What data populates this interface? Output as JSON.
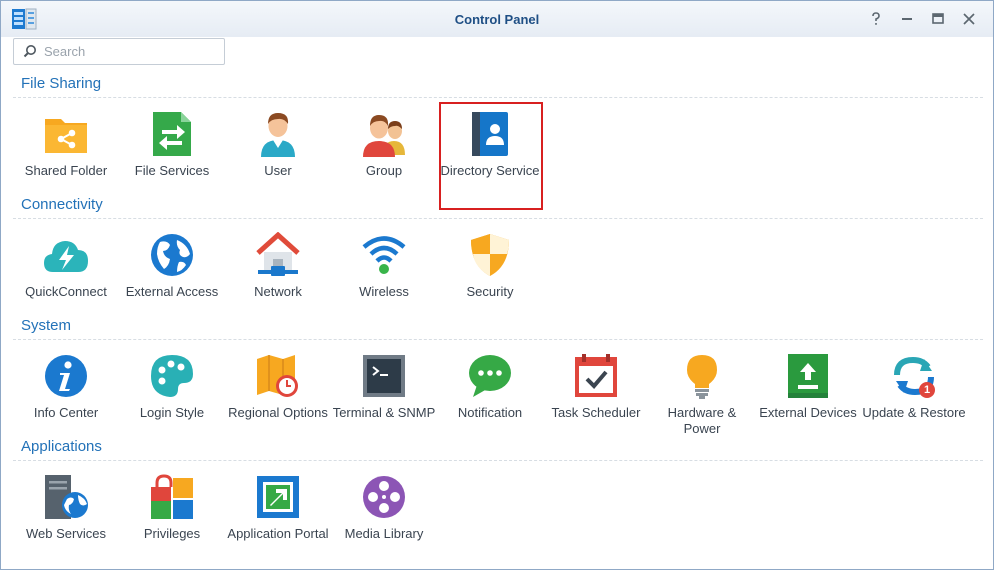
{
  "window": {
    "title": "Control Panel"
  },
  "search": {
    "placeholder": "Search"
  },
  "sections": [
    {
      "title": "File Sharing",
      "items": [
        {
          "label": "Shared Folder",
          "icon": "shared-folder-icon"
        },
        {
          "label": "File Services",
          "icon": "file-services-icon"
        },
        {
          "label": "User",
          "icon": "user-icon"
        },
        {
          "label": "Group",
          "icon": "group-icon"
        },
        {
          "label": "Directory Service",
          "icon": "directory-service-icon",
          "highlighted": true
        }
      ]
    },
    {
      "title": "Connectivity",
      "items": [
        {
          "label": "QuickConnect",
          "icon": "quickconnect-icon"
        },
        {
          "label": "External Access",
          "icon": "external-access-icon"
        },
        {
          "label": "Network",
          "icon": "network-icon"
        },
        {
          "label": "Wireless",
          "icon": "wireless-icon"
        },
        {
          "label": "Security",
          "icon": "security-icon"
        }
      ]
    },
    {
      "title": "System",
      "items": [
        {
          "label": "Info Center",
          "icon": "info-center-icon"
        },
        {
          "label": "Login Style",
          "icon": "login-style-icon"
        },
        {
          "label": "Regional Options",
          "icon": "regional-options-icon"
        },
        {
          "label": "Terminal & SNMP",
          "icon": "terminal-snmp-icon"
        },
        {
          "label": "Notification",
          "icon": "notification-icon"
        },
        {
          "label": "Task Scheduler",
          "icon": "task-scheduler-icon"
        },
        {
          "label": "Hardware & Power",
          "icon": "hardware-power-icon"
        },
        {
          "label": "External Devices",
          "icon": "external-devices-icon"
        },
        {
          "label": "Update & Restore",
          "icon": "update-restore-icon",
          "badge": "1"
        }
      ]
    },
    {
      "title": "Applications",
      "items": [
        {
          "label": "Web Services",
          "icon": "web-services-icon"
        },
        {
          "label": "Privileges",
          "icon": "privileges-icon"
        },
        {
          "label": "Application Portal",
          "icon": "application-portal-icon"
        },
        {
          "label": "Media Library",
          "icon": "media-library-icon"
        }
      ]
    }
  ],
  "colors": {
    "section_title": "#2372b8",
    "title": "#1f4f85",
    "highlight": "#d82020"
  }
}
